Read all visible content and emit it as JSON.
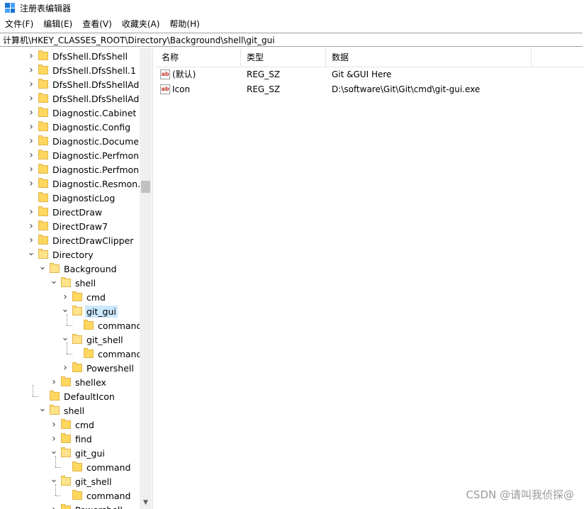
{
  "window": {
    "title": "注册表编辑器"
  },
  "menu": [
    "文件(F)",
    "编辑(E)",
    "查看(V)",
    "收藏夹(A)",
    "帮助(H)"
  ],
  "address": "计算机\\HKEY_CLASSES_ROOT\\Directory\\Background\\shell\\git_gui",
  "tree": [
    {
      "label": "DfsShell.DfsShell",
      "level": 0,
      "chevron": "right"
    },
    {
      "label": "DfsShell.DfsShell.1",
      "level": 0,
      "chevron": "right"
    },
    {
      "label": "DfsShell.DfsShellAdm",
      "level": 0,
      "chevron": "right"
    },
    {
      "label": "DfsShell.DfsShellAdm",
      "level": 0,
      "chevron": "right"
    },
    {
      "label": "Diagnostic.Cabinet",
      "level": 0,
      "chevron": "right"
    },
    {
      "label": "Diagnostic.Config",
      "level": 0,
      "chevron": "right"
    },
    {
      "label": "Diagnostic.Document",
      "level": 0,
      "chevron": "right"
    },
    {
      "label": "Diagnostic.Perfmon.C",
      "level": 0,
      "chevron": "right"
    },
    {
      "label": "Diagnostic.Perfmon.D",
      "level": 0,
      "chevron": "right"
    },
    {
      "label": "Diagnostic.Resmon.C",
      "level": 0,
      "chevron": "right"
    },
    {
      "label": "DiagnosticLog",
      "level": 0,
      "chevron": "none"
    },
    {
      "label": "DirectDraw",
      "level": 0,
      "chevron": "right"
    },
    {
      "label": "DirectDraw7",
      "level": 0,
      "chevron": "right"
    },
    {
      "label": "DirectDrawClipper",
      "level": 0,
      "chevron": "right"
    },
    {
      "label": "Directory",
      "level": 0,
      "chevron": "down"
    },
    {
      "label": "Background",
      "level": 1,
      "chevron": "down"
    },
    {
      "label": "shell",
      "level": 2,
      "chevron": "down"
    },
    {
      "label": "cmd",
      "level": 3,
      "chevron": "right"
    },
    {
      "label": "git_gui",
      "level": 3,
      "chevron": "down",
      "selected": true
    },
    {
      "label": "command",
      "level": 4,
      "chevron": "none"
    },
    {
      "label": "git_shell",
      "level": 3,
      "chevron": "down"
    },
    {
      "label": "command",
      "level": 4,
      "chevron": "none"
    },
    {
      "label": "Powershell",
      "level": 3,
      "chevron": "right"
    },
    {
      "label": "shellex",
      "level": 2,
      "chevron": "right"
    },
    {
      "label": "DefaultIcon",
      "level": 1,
      "chevron": "none"
    },
    {
      "label": "shell",
      "level": 1,
      "chevron": "down"
    },
    {
      "label": "cmd",
      "level": 2,
      "chevron": "right"
    },
    {
      "label": "find",
      "level": 2,
      "chevron": "right"
    },
    {
      "label": "git_gui",
      "level": 2,
      "chevron": "down"
    },
    {
      "label": "command",
      "level": 3,
      "chevron": "none"
    },
    {
      "label": "git_shell",
      "level": 2,
      "chevron": "down"
    },
    {
      "label": "command",
      "level": 3,
      "chevron": "none"
    },
    {
      "label": "Powershell",
      "level": 2,
      "chevron": "right"
    }
  ],
  "list": {
    "columns": [
      "名称",
      "类型",
      "数据"
    ],
    "rows": [
      {
        "name": "(默认)",
        "type": "REG_SZ",
        "data": "Git &GUI Here"
      },
      {
        "name": "Icon",
        "type": "REG_SZ",
        "data": "D:\\software\\Git\\Git\\cmd\\git-gui.exe"
      }
    ]
  },
  "watermark": "CSDN @请叫我侦探@"
}
